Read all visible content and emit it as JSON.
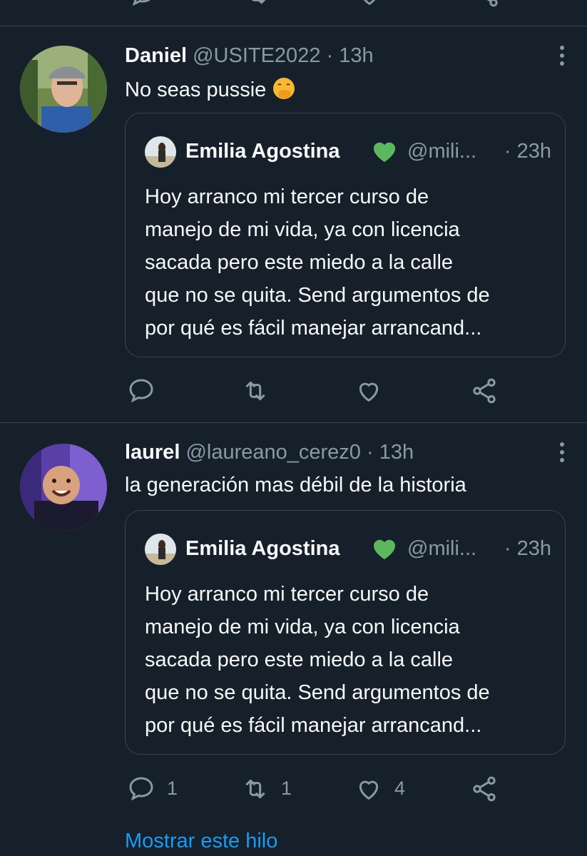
{
  "colors": {
    "background": "#15202b",
    "divider": "#38444d",
    "muted": "#8b98a5",
    "text": "#f7f9f9",
    "link": "#1d9bf0",
    "heart_emoji": "#5cb85c"
  },
  "tweets": [
    {
      "name": "Daniel",
      "handle": "@USITE2022",
      "separator": "·",
      "time": "13h",
      "text": "No seas pussie",
      "emoji": "face-with-hand-over-mouth",
      "avatar_icon": "man-with-cap-avatar",
      "quote": {
        "name": "Emilia Agostina",
        "emoji": "green-heart",
        "handle": "@mili...",
        "time": "· 23h",
        "lines": [
          "Hoy arranco mi tercer curso de",
          "manejo de mi vida, ya con licencia",
          "sacada pero este miedo a la calle",
          "que no se quita. Send argumentos de",
          "por qué es fácil manejar arrancand..."
        ]
      },
      "actions": {
        "reply": "",
        "retweet": "",
        "like": ""
      }
    },
    {
      "name": "laurel",
      "handle": "@laureano_cerez0",
      "separator": "·",
      "time": "13h",
      "text": "la generación mas débil de la historia",
      "avatar_icon": "smiling-child-avatar",
      "quote": {
        "name": "Emilia Agostina",
        "emoji": "green-heart",
        "handle": "@mili...",
        "time": "· 23h",
        "lines": [
          "Hoy arranco mi tercer curso de",
          "manejo de mi vida, ya con licencia",
          "sacada pero este miedo a la calle",
          "que no se quita. Send argumentos de",
          "por qué es fácil manejar arrancand..."
        ]
      },
      "actions": {
        "reply": "1",
        "retweet": "1",
        "like": "4"
      }
    }
  ],
  "show_thread": "Mostrar este hilo",
  "icons": {
    "reply": "reply-icon",
    "retweet": "retweet-icon",
    "like": "like-icon",
    "share": "share-icon",
    "more": "more-icon"
  }
}
